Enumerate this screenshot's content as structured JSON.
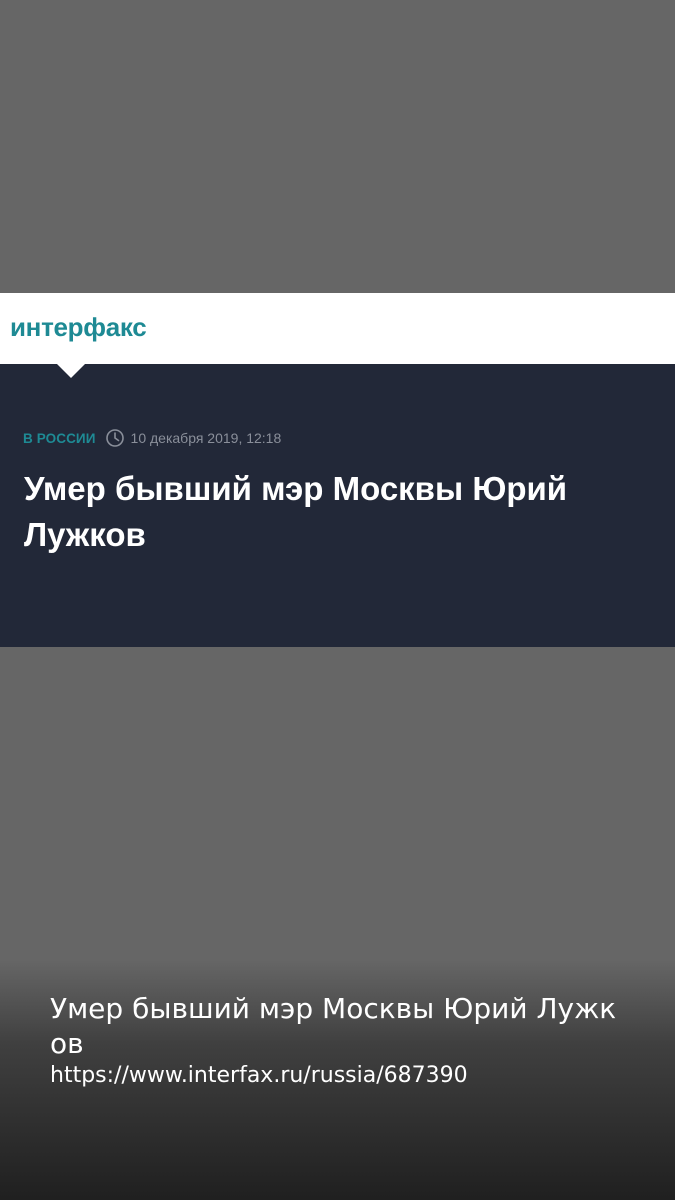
{
  "header": {
    "logo_text": "интерфакс"
  },
  "article": {
    "category": "В РОССИИ",
    "date": "10 декабря 2019, 12:18",
    "headline": "Умер бывший мэр Москвы Юрий Лужков"
  },
  "share": {
    "title": "Умер бывший мэр Москвы Юрий Лужков",
    "url": "https://www.interfax.ru/russia/687390"
  },
  "colors": {
    "background": "#666666",
    "header_bg": "#ffffff",
    "dark_block_bg": "#222838",
    "brand_teal": "#1e8a94",
    "date_gray": "#8a8f9a",
    "text_white": "#ffffff"
  },
  "icons": [
    "clock-icon"
  ]
}
